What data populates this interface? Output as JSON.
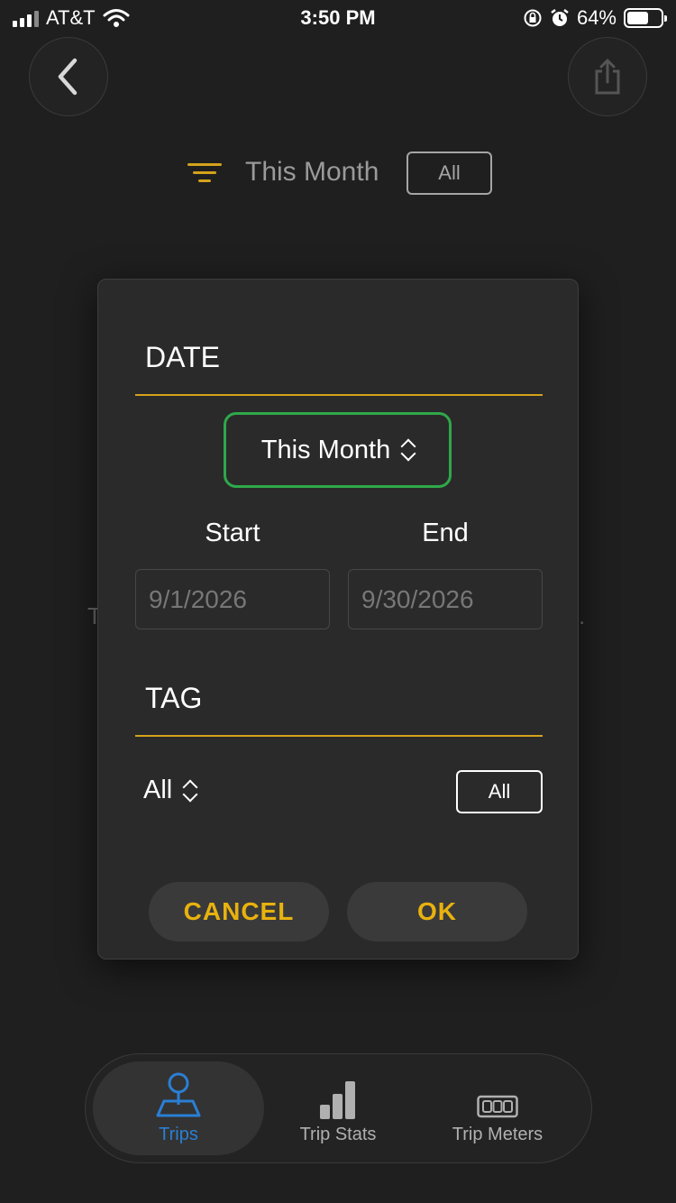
{
  "status_bar": {
    "carrier": "AT&T",
    "time": "3:50 PM",
    "battery": "64%",
    "battery_level": 0.64
  },
  "header": {
    "back_icon": "chevron-left-icon",
    "share_icon": "share-icon"
  },
  "filter_summary": {
    "icon": "filter-icon",
    "range_label": "This Month",
    "tag_label": "All"
  },
  "dialog": {
    "date_section_title": "DATE",
    "range_value": "This Month",
    "start_label": "Start",
    "end_label": "End",
    "start_value": "9/1/2026",
    "end_value": "9/30/2026",
    "tag_section_title": "TAG",
    "tag_value": "All",
    "tag_button_label": "All",
    "cancel_label": "CANCEL",
    "ok_label": "OK"
  },
  "tabs": [
    {
      "label": "Trips",
      "icon": "map-pin-icon",
      "active": true
    },
    {
      "label": "Trip Stats",
      "icon": "bar-chart-icon",
      "active": false
    },
    {
      "label": "Trip Meters",
      "icon": "odometer-icon",
      "active": false
    }
  ],
  "colors": {
    "accent": "#d4a21b",
    "button_text": "#e8b20e",
    "focus_outline": "#2fa84a",
    "active_tab": "#2a7fd4"
  }
}
